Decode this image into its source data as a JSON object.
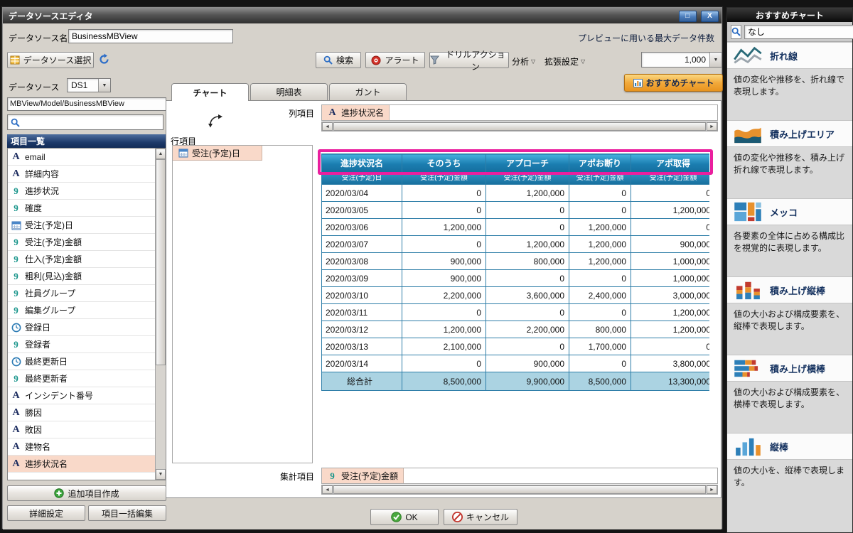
{
  "window": {
    "title": "データソースエディタ"
  },
  "icons": {
    "maximize": "□",
    "close": "X",
    "dropdown_arrow": "▼",
    "menu_arrow_down": "▽",
    "scroll_up": "▲",
    "scroll_down": "▼",
    "scroll_left": "◄",
    "scroll_right": "►"
  },
  "header": {
    "datasource_name_label": "データソース名",
    "datasource_name_value": "BusinessMBView",
    "preview_max_label": "プレビューに用いる最大データ件数",
    "max_rows_value": "1,000"
  },
  "toolbar": {
    "select_datasource": "データソース選択",
    "search": "検索",
    "alert": "アラート",
    "drill_action": "ドリルアクション",
    "analysis": "分析",
    "extended_settings": "拡張設定",
    "recommended_chart": "おすすめチャート"
  },
  "left_panel": {
    "datasource_label": "データソース",
    "datasource_value": "DS1",
    "model_path": "MBView/Model/BusinessMBView",
    "search_value": "",
    "item_list_header": "項目一覧",
    "fields": [
      {
        "type": "text",
        "label": "email"
      },
      {
        "type": "text",
        "label": "詳細内容"
      },
      {
        "type": "number",
        "label": "進捗状況"
      },
      {
        "type": "number",
        "label": "確度"
      },
      {
        "type": "date",
        "label": "受注(予定)日"
      },
      {
        "type": "number",
        "label": "受注(予定)金額"
      },
      {
        "type": "number",
        "label": "仕入(予定)金額"
      },
      {
        "type": "number",
        "label": "粗利(見込)金額"
      },
      {
        "type": "number",
        "label": "社員グループ"
      },
      {
        "type": "number",
        "label": "編集グループ"
      },
      {
        "type": "datetime",
        "label": "登録日"
      },
      {
        "type": "number",
        "label": "登録者"
      },
      {
        "type": "datetime",
        "label": "最終更新日"
      },
      {
        "type": "number",
        "label": "最終更新者"
      },
      {
        "type": "text",
        "label": "インシデント番号"
      },
      {
        "type": "text",
        "label": "勝因"
      },
      {
        "type": "text",
        "label": "敗因"
      },
      {
        "type": "text",
        "label": "建物名"
      },
      {
        "type": "text",
        "label": "進捗状況名",
        "highlighted": true
      }
    ],
    "add_item_button": "追加項目作成",
    "detail_settings_button": "詳細設定",
    "bulk_edit_button": "項目一括編集"
  },
  "tabs": {
    "items": [
      "チャート",
      "明細表",
      "ガント"
    ],
    "active": "チャート"
  },
  "pivot": {
    "column_items_label": "列項目",
    "column_field": {
      "type": "text",
      "label": "進捗状況名"
    },
    "row_items_label": "行項目",
    "row_field": {
      "type": "date",
      "label": "受注(予定)日"
    },
    "aggregate_items_label": "集計項目",
    "aggregate_field": {
      "type": "number",
      "label": "受注(予定)金額"
    }
  },
  "chart_data": {
    "type": "table",
    "column_headers": [
      "進捗状況名",
      "そのうち",
      "アプローチ",
      "アポお断り",
      "アポ取得"
    ],
    "sub_headers": [
      "受注(予定)日",
      "受注(予定)金額",
      "受注(予定)金額",
      "受注(予定)金額",
      "受注(予定)金額"
    ],
    "rows": [
      [
        "2020/03/04",
        "0",
        "1,200,000",
        "0",
        "0"
      ],
      [
        "2020/03/05",
        "0",
        "0",
        "0",
        "1,200,000"
      ],
      [
        "2020/03/06",
        "1,200,000",
        "0",
        "1,200,000",
        "0"
      ],
      [
        "2020/03/07",
        "0",
        "1,200,000",
        "1,200,000",
        "900,000"
      ],
      [
        "2020/03/08",
        "900,000",
        "800,000",
        "1,200,000",
        "1,000,000"
      ],
      [
        "2020/03/09",
        "900,000",
        "0",
        "0",
        "1,000,000"
      ],
      [
        "2020/03/10",
        "2,200,000",
        "3,600,000",
        "2,400,000",
        "3,000,000"
      ],
      [
        "2020/03/11",
        "0",
        "0",
        "0",
        "1,200,000"
      ],
      [
        "2020/03/12",
        "1,200,000",
        "2,200,000",
        "800,000",
        "1,200,000"
      ],
      [
        "2020/03/13",
        "2,100,000",
        "0",
        "1,700,000",
        "0"
      ],
      [
        "2020/03/14",
        "0",
        "900,000",
        "0",
        "3,800,000"
      ]
    ],
    "total_row": [
      "総合計",
      "8,500,000",
      "9,900,000",
      "8,500,000",
      "13,300,000"
    ]
  },
  "footer": {
    "ok": "OK",
    "cancel": "キャンセル"
  },
  "right_panel": {
    "header": "おすすめチャート",
    "search_value": "なし",
    "charts": [
      {
        "id": "line",
        "icon": "line-chart-icon",
        "name": "折れ線",
        "desc": "値の変化や推移を、折れ線で表現します。"
      },
      {
        "id": "stacked-area",
        "icon": "stacked-area-icon",
        "name": "積み上げエリア",
        "desc": "値の変化や推移を、積み上げ折れ線で表現します。"
      },
      {
        "id": "mekko",
        "icon": "mekko-icon",
        "name": "メッコ",
        "desc": "各要素の全体に占める構成比を視覚的に表現します。"
      },
      {
        "id": "stacked-column",
        "icon": "stacked-column-icon",
        "name": "積み上げ縦棒",
        "desc": "値の大小および構成要素を、縦棒で表現します。"
      },
      {
        "id": "stacked-bar",
        "icon": "stacked-bar-icon",
        "name": "積み上げ横棒",
        "desc": "値の大小および構成要素を、横棒で表現します。"
      },
      {
        "id": "column",
        "icon": "column-icon",
        "name": "縦棒",
        "desc": "値の大小を、縦棒で表現します。"
      }
    ]
  },
  "colors": {
    "table_header_blue": "#1b7db0",
    "total_row_blue": "#abd3e2",
    "highlight_pink": "#f9d9c9",
    "annotation_magenta": "#ea1f9e",
    "recommended_button_orange": "#f2a93b"
  }
}
